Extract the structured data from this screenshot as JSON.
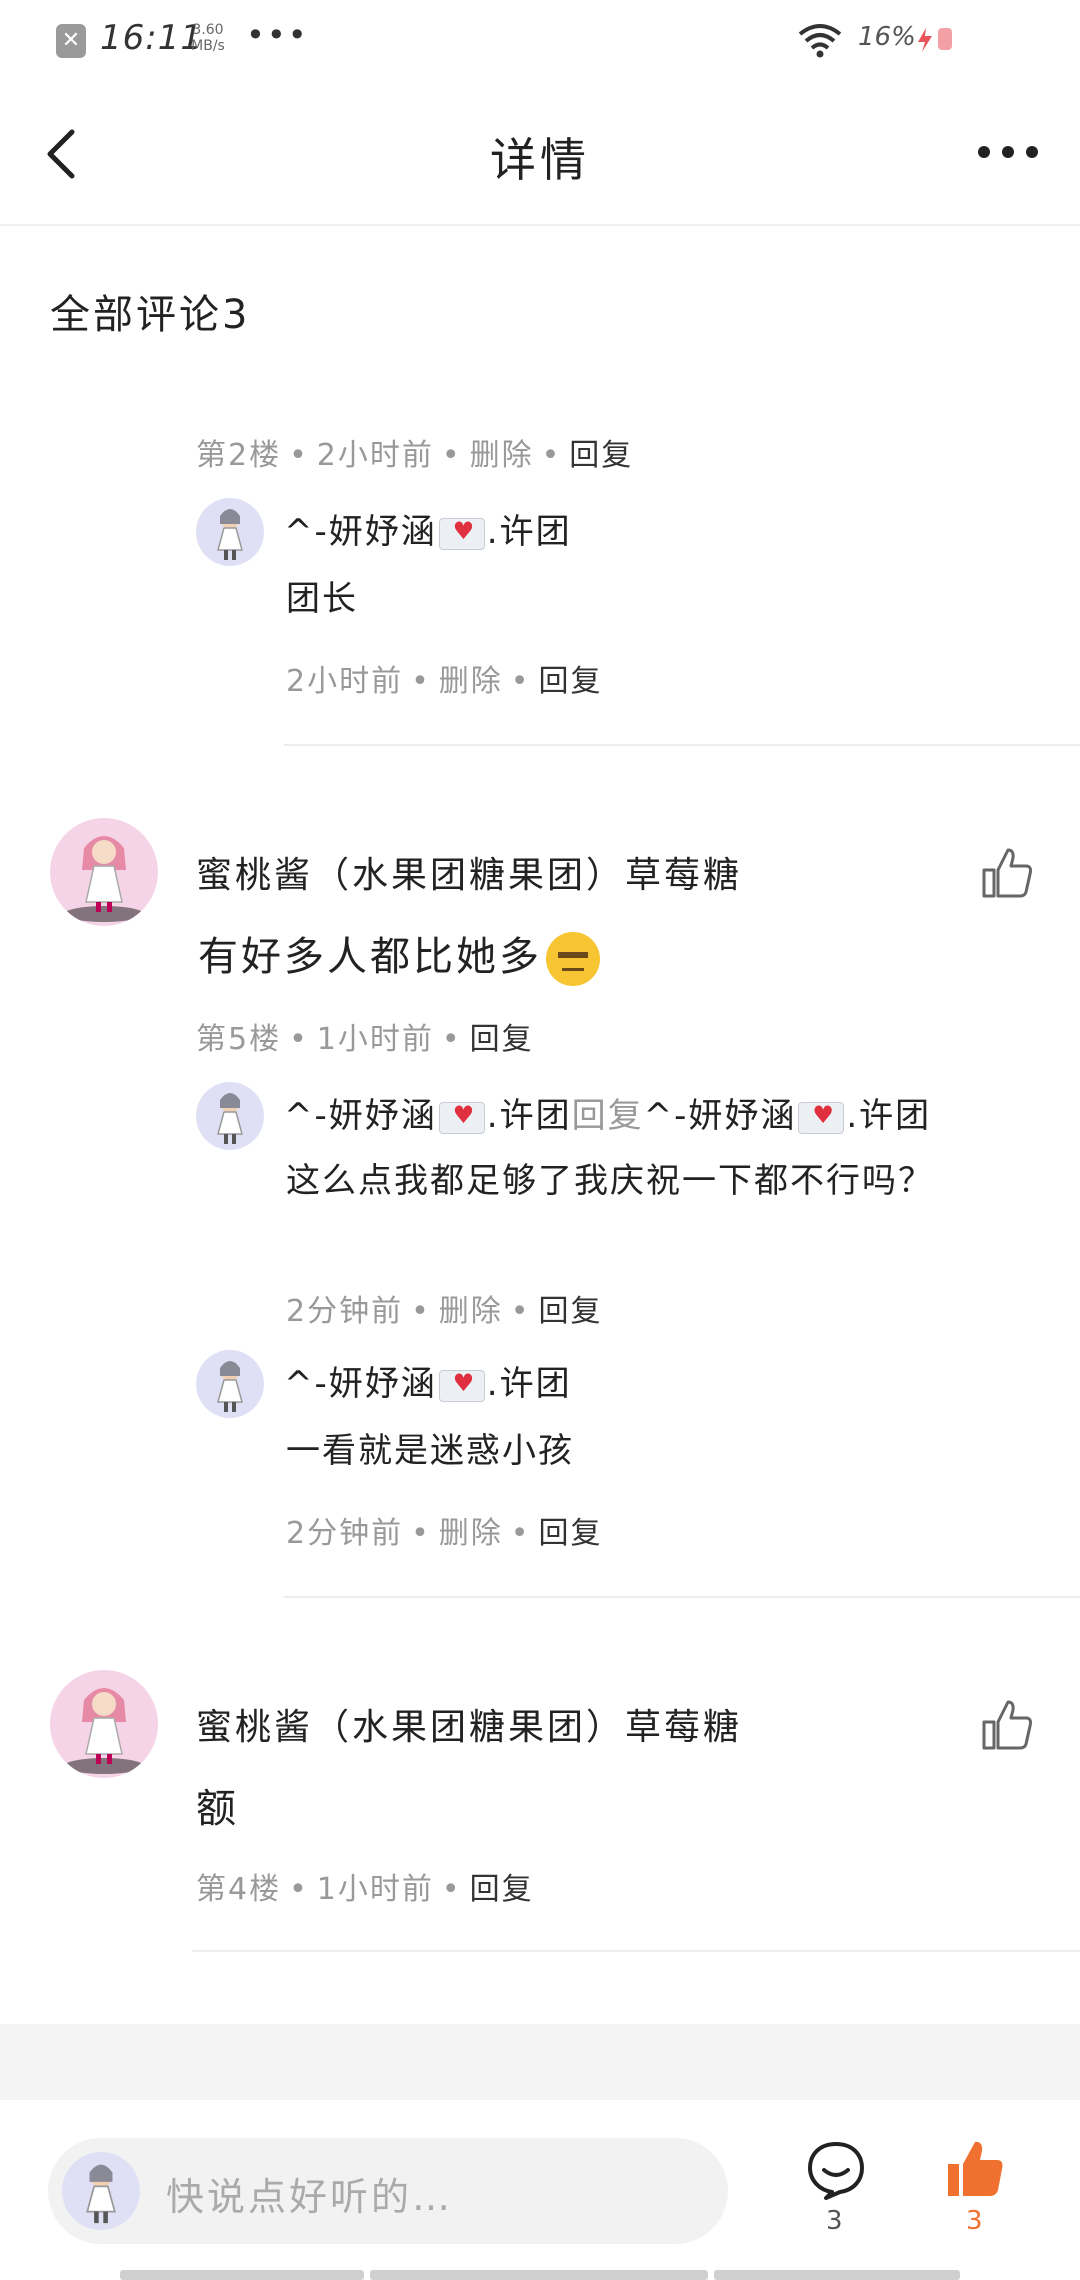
{
  "status_bar": {
    "time": "16:11",
    "speed_value": "3.60",
    "speed_unit": "MB/s",
    "dots": "•••",
    "battery": "16%"
  },
  "header": {
    "title": "详情"
  },
  "comments_section": {
    "title": "全部评论3"
  },
  "thread_1": {
    "meta": {
      "floor": "第2楼",
      "time": "2小时前",
      "delete": "删除",
      "reply": "回复"
    },
    "reply_1": {
      "name": "^-妍妤涵",
      "name_suffix": ".许团",
      "text": "团长",
      "time": "2小时前",
      "delete": "删除",
      "reply": "回复"
    }
  },
  "comment_2": {
    "name": "蜜桃酱（水果团糖果团）草莓糖",
    "text": "有好多人都比她多",
    "emoji": "expressionless-face",
    "floor": "第5楼",
    "time": "1小时前",
    "reply": "回复",
    "reply_1": {
      "name": "^-妍妤涵",
      "name_suffix": ".许团",
      "reply_word": "回复",
      "target_name": "^-妍妤涵",
      "target_suffix": ".许团",
      "text": "这么点我都足够了我庆祝一下都不行吗？",
      "time": "2分钟前",
      "delete": "删除",
      "reply": "回复"
    },
    "reply_2": {
      "name": "^-妍妤涵",
      "name_suffix": ".许团",
      "text": "一看就是迷惑小孩",
      "time": "2分钟前",
      "delete": "删除",
      "reply": "回复"
    }
  },
  "comment_3": {
    "name": "蜜桃酱（水果团糖果团）草莓糖",
    "text": "额",
    "floor": "第4楼",
    "time": "1小时前",
    "reply": "回复"
  },
  "bottom_bar": {
    "placeholder": "快说点好听的…",
    "comment_count": "3",
    "like_count": "3"
  },
  "colors": {
    "accent_orange": "#f07030",
    "muted_text": "#999999",
    "divider": "#ededed"
  }
}
